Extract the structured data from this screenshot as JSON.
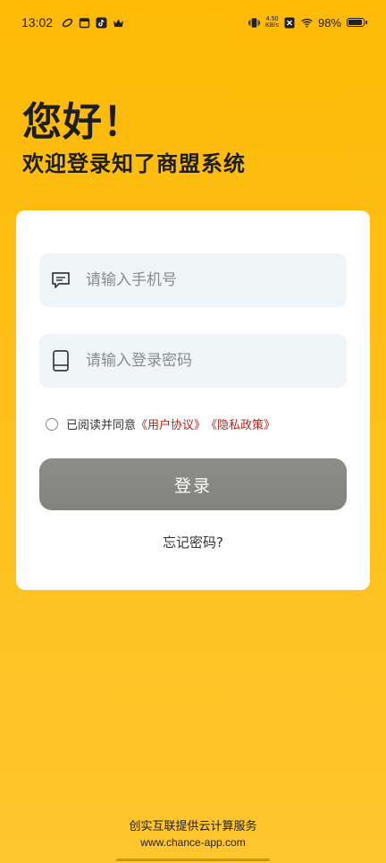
{
  "status_bar": {
    "time": "13:02",
    "net_speed_value": "4.50",
    "net_speed_unit": "KB/s",
    "battery_percent": "98%",
    "battery_level": 0.98,
    "icons": [
      "link-icon",
      "calendar-icon",
      "tiktok-icon",
      "crown-icon",
      "vibrate-icon",
      "sim-off-icon",
      "wifi-icon",
      "battery-icon"
    ]
  },
  "header": {
    "greeting": "您好！",
    "subtitle": "欢迎登录知了商盟系统"
  },
  "form": {
    "phone_placeholder": "请输入手机号",
    "phone_value": "",
    "password_placeholder": "请输入登录密码",
    "password_value": "",
    "agree_text": "已阅读并同意",
    "user_agreement": "《用户协议》",
    "privacy_policy": "《隐私政策》",
    "agree_checked": false,
    "login_label": "登录",
    "forgot_label": "忘记密码?"
  },
  "footer": {
    "line1": "创实互联提供云计算服务",
    "line2": "www.chance-app.com"
  },
  "colors": {
    "background": "#FDBB06",
    "link": "#B3261E",
    "button_disabled": "#8A8A87",
    "field_bg": "#EFF4F6"
  }
}
